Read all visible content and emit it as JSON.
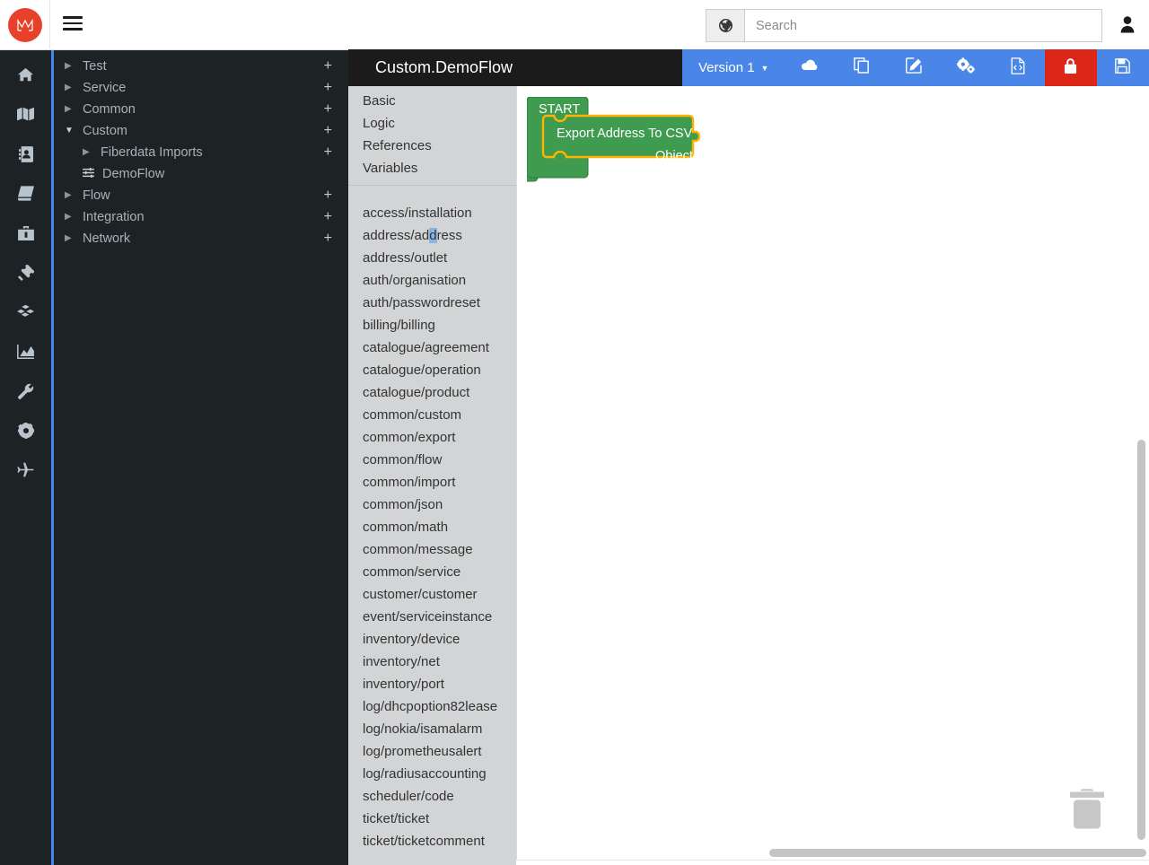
{
  "app": {
    "logo_text": "M",
    "logo_color": "#e8412a",
    "accent_color": "#4a86e8",
    "danger_color": "#dc2617",
    "panel_dark": "#1d2225"
  },
  "topbar": {
    "menu_icon": "hamburger-icon",
    "globe_icon": "globe-icon",
    "search_placeholder": "Search",
    "search_value": "",
    "user_icon": "user-icon"
  },
  "rail": {
    "items": [
      {
        "icon": "home-icon",
        "name": "home"
      },
      {
        "icon": "map-icon",
        "name": "map"
      },
      {
        "icon": "address-book-icon",
        "name": "address-book"
      },
      {
        "icon": "book-icon",
        "name": "book"
      },
      {
        "icon": "briefcase-icon",
        "name": "briefcase"
      },
      {
        "icon": "ticket-icon",
        "name": "ticket"
      },
      {
        "icon": "cubes-icon",
        "name": "cubes"
      },
      {
        "icon": "chart-area-icon",
        "name": "chart-area"
      },
      {
        "icon": "wrench-icon",
        "name": "wrench"
      },
      {
        "icon": "gear-icon",
        "name": "gear"
      },
      {
        "icon": "plane-icon",
        "name": "plane"
      }
    ]
  },
  "tree": {
    "items": [
      {
        "label": "Test",
        "caret": "▶",
        "expanded": false,
        "plus": "+",
        "indent": false,
        "leaf": false
      },
      {
        "label": "Service",
        "caret": "▶",
        "expanded": false,
        "plus": "+",
        "indent": false,
        "leaf": false
      },
      {
        "label": "Common",
        "caret": "▶",
        "expanded": false,
        "plus": "+",
        "indent": false,
        "leaf": false
      },
      {
        "label": "Custom",
        "caret": "▼",
        "expanded": true,
        "plus": "+",
        "indent": false,
        "leaf": false
      },
      {
        "label": "Fiberdata Imports",
        "caret": "▶",
        "expanded": false,
        "plus": "+",
        "indent": true,
        "leaf": false
      },
      {
        "label": "DemoFlow",
        "caret": "",
        "expanded": false,
        "plus": "",
        "indent": true,
        "leaf": true
      },
      {
        "label": "Flow",
        "caret": "▶",
        "expanded": false,
        "plus": "+",
        "indent": false,
        "leaf": false
      },
      {
        "label": "Integration",
        "caret": "▶",
        "expanded": false,
        "plus": "+",
        "indent": false,
        "leaf": false
      },
      {
        "label": "Network",
        "caret": "▶",
        "expanded": false,
        "plus": "+",
        "indent": false,
        "leaf": false
      }
    ]
  },
  "flow": {
    "title": "Custom.DemoFlow"
  },
  "toolbar": {
    "version_label": "Version 1",
    "version_caret": "▼",
    "buttons": [
      {
        "name": "deploy-button",
        "icon": "cloud-upload-icon",
        "danger": false
      },
      {
        "name": "copy-button",
        "icon": "copy-icon",
        "danger": false
      },
      {
        "name": "edit-button",
        "icon": "edit-icon",
        "danger": false
      },
      {
        "name": "settings-button",
        "icon": "cogs-icon",
        "danger": false
      },
      {
        "name": "code-button",
        "icon": "file-code-icon",
        "danger": false
      },
      {
        "name": "lock-button",
        "icon": "lock-icon",
        "danger": true
      },
      {
        "name": "save-button",
        "icon": "floppy-save-icon",
        "danger": false
      }
    ]
  },
  "toolbox": {
    "categories": [
      "Basic",
      "Logic",
      "References",
      "Variables"
    ],
    "modules": [
      "access/installation",
      "address/address",
      "address/outlet",
      "auth/organisation",
      "auth/passwordreset",
      "billing/billing",
      "catalogue/agreement",
      "catalogue/operation",
      "catalogue/product",
      "common/custom",
      "common/export",
      "common/flow",
      "common/import",
      "common/json",
      "common/math",
      "common/message",
      "common/service",
      "customer/customer",
      "event/serviceinstance",
      "inventory/device",
      "inventory/net",
      "inventory/port",
      "log/dhcpoption82lease",
      "log/nokia/isamalarm",
      "log/prometheusalert",
      "log/radiusaccounting",
      "scheduler/code",
      "ticket/ticket",
      "ticket/ticketcomment"
    ],
    "selected_module": "address/address",
    "selection_fill": "#88b4e8"
  },
  "canvas": {
    "blocks": {
      "start_label": "START",
      "action_title": "Export Address To CSV",
      "action_output": "Object",
      "block_fill": "#3f9b4f",
      "block_stroke": "#2f7a3c",
      "selected_stroke": "#ffb300"
    },
    "trash_icon": "trash-icon",
    "vertical_scrollbar": "v-scrollbar",
    "horizontal_scrollbar": "h-scrollbar"
  }
}
